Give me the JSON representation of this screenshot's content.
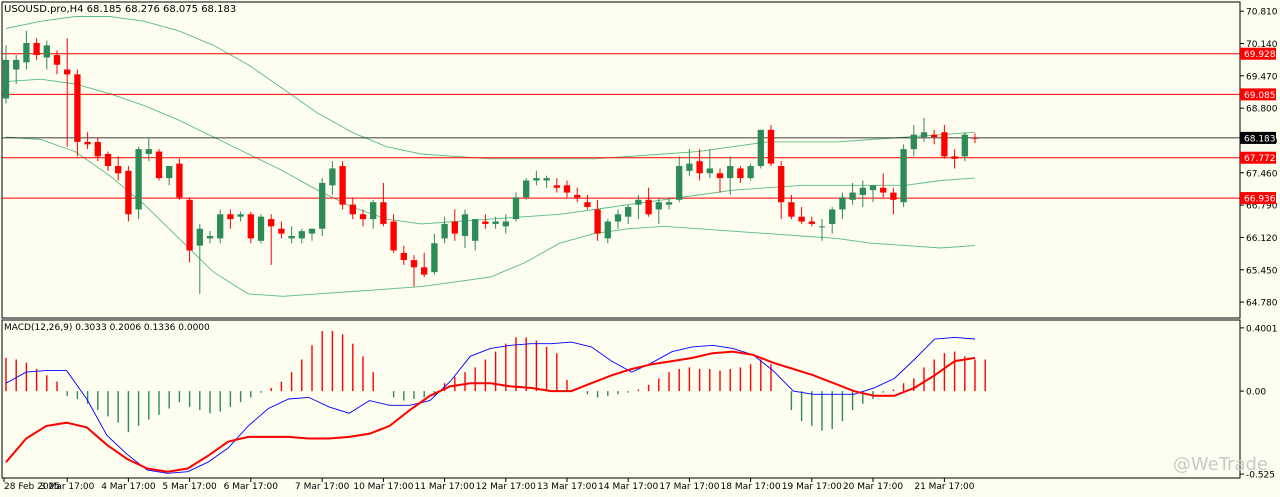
{
  "header": {
    "symbol_info": "USOUSD.pro,H4  68.185 68.276 68.075 68.183",
    "macd_info": "MACD(12,26,9) 0.3033 0.2006 0.1336 0.0000"
  },
  "watermark": "@WeTrade",
  "colors": {
    "background": "#fdfdf0",
    "bull": "#2e8b57",
    "bear": "#ff0000",
    "bands": "#3cb371",
    "level_line": "#ff0000",
    "macd_line": "#0000ff",
    "signal_line": "#ff0000"
  },
  "chart_data": [
    {
      "type": "candlestick",
      "symbol": "USOUSD.pro",
      "timeframe": "H4",
      "ylim": [
        64.45,
        71.0
      ],
      "y_ticks": [
        "70.810",
        "70.140",
        "69.470",
        "68.800",
        "68.130",
        "67.460",
        "66.790",
        "66.120",
        "65.450",
        "64.780"
      ],
      "x_ticks": [
        "28 Feb 2025",
        "3 Mar 17:00",
        "4 Mar 17:00",
        "5 Mar 17:00",
        "6 Mar 17:00",
        "7 Mar 17:00",
        "10 Mar 17:00",
        "11 Mar 17:00",
        "12 Mar 17:00",
        "13 Mar 17:00",
        "14 Mar 17:00",
        "17 Mar 17:00",
        "18 Mar 17:00",
        "19 Mar 17:00",
        "20 Mar 17:00",
        "21 Mar 17:00"
      ],
      "horizontal_levels": [
        {
          "value": 69.928,
          "label": "69.928"
        },
        {
          "value": 69.085,
          "label": "69.085"
        },
        {
          "value": 67.772,
          "label": "67.772"
        },
        {
          "value": 66.936,
          "label": "66.936"
        }
      ],
      "current_price": {
        "value": 68.183,
        "label": "68.183"
      },
      "candles": [
        [
          69.0,
          70.1,
          68.9,
          69.8
        ],
        [
          69.6,
          69.9,
          69.3,
          69.8
        ],
        [
          69.75,
          70.4,
          69.6,
          70.15
        ],
        [
          70.15,
          70.25,
          69.8,
          69.9
        ],
        [
          69.85,
          70.2,
          69.6,
          70.1
        ],
        [
          69.9,
          70.0,
          69.5,
          69.7
        ],
        [
          69.6,
          70.25,
          68.0,
          69.5
        ],
        [
          69.5,
          69.6,
          67.8,
          68.1
        ],
        [
          68.1,
          68.3,
          67.95,
          68.05
        ],
        [
          68.1,
          68.2,
          67.7,
          67.8
        ],
        [
          67.85,
          67.9,
          67.5,
          67.6
        ],
        [
          67.6,
          67.8,
          67.3,
          67.45
        ],
        [
          67.5,
          67.6,
          66.45,
          66.6
        ],
        [
          66.7,
          68.0,
          66.5,
          67.95
        ],
        [
          67.85,
          68.2,
          67.7,
          67.95
        ],
        [
          67.9,
          67.95,
          67.3,
          67.35
        ],
        [
          67.35,
          67.6,
          67.2,
          67.6
        ],
        [
          67.65,
          67.75,
          66.9,
          66.95
        ],
        [
          66.9,
          66.95,
          65.6,
          65.85
        ],
        [
          65.95,
          66.4,
          64.95,
          66.3
        ],
        [
          66.1,
          66.25,
          66.0,
          66.15
        ],
        [
          66.1,
          66.7,
          66.0,
          66.6
        ],
        [
          66.6,
          66.7,
          66.3,
          66.5
        ],
        [
          66.55,
          66.65,
          66.45,
          66.6
        ],
        [
          66.6,
          66.65,
          66.0,
          66.1
        ],
        [
          66.05,
          66.6,
          66.0,
          66.55
        ],
        [
          66.5,
          66.6,
          65.55,
          66.35
        ],
        [
          66.3,
          66.45,
          66.1,
          66.2
        ],
        [
          66.1,
          66.35,
          66.0,
          66.15
        ],
        [
          66.1,
          66.3,
          66.0,
          66.25
        ],
        [
          66.2,
          66.3,
          66.05,
          66.3
        ],
        [
          66.3,
          67.35,
          66.15,
          67.25
        ],
        [
          67.2,
          67.7,
          67.0,
          67.55
        ],
        [
          67.6,
          67.7,
          66.7,
          66.8
        ],
        [
          66.8,
          66.95,
          66.5,
          66.6
        ],
        [
          66.6,
          66.7,
          66.35,
          66.5
        ],
        [
          66.5,
          66.9,
          66.3,
          66.85
        ],
        [
          66.85,
          67.25,
          66.35,
          66.4
        ],
        [
          66.45,
          66.6,
          65.8,
          65.85
        ],
        [
          65.8,
          65.95,
          65.55,
          65.65
        ],
        [
          65.65,
          65.75,
          65.1,
          65.5
        ],
        [
          65.5,
          65.8,
          65.3,
          65.35
        ],
        [
          65.4,
          66.2,
          65.35,
          66.0
        ],
        [
          66.1,
          66.55,
          66.0,
          66.4
        ],
        [
          66.45,
          66.7,
          66.05,
          66.2
        ],
        [
          66.15,
          66.7,
          65.9,
          66.6
        ],
        [
          66.05,
          66.5,
          65.85,
          66.5
        ],
        [
          66.45,
          66.6,
          66.3,
          66.4
        ],
        [
          66.4,
          66.55,
          66.3,
          66.45
        ],
        [
          66.35,
          66.6,
          66.2,
          66.45
        ],
        [
          66.5,
          67.05,
          66.45,
          66.95
        ],
        [
          66.95,
          67.35,
          66.9,
          67.3
        ],
        [
          67.3,
          67.5,
          67.2,
          67.35
        ],
        [
          67.3,
          67.4,
          67.15,
          67.35
        ],
        [
          67.2,
          67.35,
          67.05,
          67.15
        ],
        [
          67.2,
          67.3,
          66.95,
          67.05
        ],
        [
          67.0,
          67.15,
          66.85,
          66.95
        ],
        [
          66.85,
          67.0,
          66.7,
          66.75
        ],
        [
          66.7,
          66.9,
          66.05,
          66.2
        ],
        [
          66.1,
          66.5,
          66.0,
          66.45
        ],
        [
          66.45,
          66.7,
          66.3,
          66.6
        ],
        [
          66.55,
          66.8,
          66.4,
          66.75
        ],
        [
          66.8,
          67.0,
          66.5,
          66.9
        ],
        [
          66.9,
          67.15,
          66.55,
          66.6
        ],
        [
          66.7,
          66.95,
          66.4,
          66.85
        ],
        [
          66.8,
          66.95,
          66.7,
          66.85
        ],
        [
          66.9,
          67.8,
          66.85,
          67.6
        ],
        [
          67.5,
          67.95,
          67.4,
          67.65
        ],
        [
          67.7,
          67.95,
          67.3,
          67.45
        ],
        [
          67.45,
          67.95,
          67.35,
          67.55
        ],
        [
          67.45,
          67.55,
          67.05,
          67.35
        ],
        [
          67.35,
          67.8,
          67.0,
          67.6
        ],
        [
          67.55,
          67.6,
          67.25,
          67.35
        ],
        [
          67.35,
          67.65,
          67.3,
          67.6
        ],
        [
          67.6,
          68.35,
          67.55,
          68.35
        ],
        [
          68.35,
          68.45,
          67.6,
          67.65
        ],
        [
          67.6,
          67.7,
          66.5,
          66.85
        ],
        [
          66.85,
          67.0,
          66.5,
          66.55
        ],
        [
          66.55,
          66.75,
          66.4,
          66.45
        ],
        [
          66.45,
          66.55,
          66.35,
          66.4
        ],
        [
          66.35,
          66.5,
          66.05,
          66.35
        ],
        [
          66.4,
          66.75,
          66.2,
          66.7
        ],
        [
          66.7,
          67.05,
          66.5,
          66.95
        ],
        [
          66.9,
          67.25,
          66.8,
          67.05
        ],
        [
          67.0,
          67.3,
          66.75,
          67.15
        ],
        [
          67.1,
          67.2,
          66.85,
          67.2
        ],
        [
          67.15,
          67.45,
          66.95,
          67.05
        ],
        [
          67.05,
          67.15,
          66.6,
          66.9
        ],
        [
          66.85,
          68.05,
          66.75,
          67.95
        ],
        [
          67.95,
          68.45,
          67.8,
          68.25
        ],
        [
          68.2,
          68.6,
          68.1,
          68.3
        ],
        [
          68.25,
          68.35,
          68.05,
          68.2
        ],
        [
          68.3,
          68.45,
          67.75,
          67.8
        ],
        [
          67.8,
          67.95,
          67.55,
          67.75
        ],
        [
          67.8,
          68.3,
          67.7,
          68.25
        ],
        [
          68.185,
          68.276,
          68.075,
          68.183
        ]
      ],
      "bollinger": {
        "upper": [
          70.45,
          70.6,
          70.7,
          70.7,
          70.6,
          70.4,
          70.1,
          69.7,
          69.2,
          68.7,
          68.3,
          68.0,
          67.85,
          67.8,
          67.75,
          67.75,
          67.75,
          67.75,
          67.8,
          67.85,
          67.9,
          68.0,
          68.1,
          68.1,
          68.1,
          68.15,
          68.2,
          68.25,
          68.3
        ],
        "mid": [
          69.35,
          69.4,
          69.3,
          69.1,
          68.85,
          68.55,
          68.2,
          67.85,
          67.5,
          67.1,
          66.75,
          66.5,
          66.4,
          66.45,
          66.5,
          66.55,
          66.6,
          66.7,
          66.8,
          66.9,
          67.0,
          67.1,
          67.15,
          67.2,
          67.2,
          67.2,
          67.2,
          67.3,
          67.35
        ],
        "lower": [
          68.2,
          68.15,
          67.9,
          67.4,
          66.8,
          66.1,
          65.4,
          64.95,
          64.9,
          64.95,
          65.0,
          65.05,
          65.1,
          65.2,
          65.3,
          65.6,
          66.0,
          66.2,
          66.3,
          66.35,
          66.3,
          66.25,
          66.2,
          66.15,
          66.1,
          66.0,
          65.95,
          65.9,
          65.95
        ]
      }
    },
    {
      "type": "histogram+line",
      "title": "MACD(12,26,9)",
      "ylim": [
        -0.55,
        0.45
      ],
      "y_ticks": [
        "0.4001",
        "0.00",
        "-0.525"
      ],
      "histogram": [
        0.21,
        0.2,
        0.18,
        0.14,
        0.1,
        0.06,
        -0.03,
        -0.05,
        -0.08,
        -0.12,
        -0.16,
        -0.2,
        -0.26,
        -0.22,
        -0.18,
        -0.15,
        -0.11,
        -0.07,
        -0.1,
        -0.12,
        -0.14,
        -0.13,
        -0.1,
        -0.07,
        -0.04,
        -0.01,
        0.02,
        0.06,
        0.12,
        0.2,
        0.29,
        0.38,
        0.38,
        0.36,
        0.3,
        0.22,
        0.12,
        0.0,
        -0.04,
        -0.06,
        -0.05,
        -0.04,
        -0.03,
        0.05,
        0.09,
        0.12,
        0.15,
        0.2,
        0.25,
        0.3,
        0.34,
        0.34,
        0.32,
        0.28,
        0.24,
        0.07,
        0.0,
        -0.02,
        -0.04,
        -0.03,
        -0.02,
        -0.01,
        0.01,
        0.04,
        0.08,
        0.12,
        0.14,
        0.15,
        0.14,
        0.14,
        0.13,
        0.14,
        0.15,
        0.17,
        0.2,
        0.17,
        0.0,
        -0.12,
        -0.19,
        -0.22,
        -0.25,
        -0.24,
        -0.19,
        -0.12,
        -0.08,
        -0.05,
        -0.01,
        0.01,
        0.05,
        0.08,
        0.15,
        0.2,
        0.24,
        0.25,
        0.22,
        0.2,
        0.2
      ],
      "macd_line": [
        0.05,
        0.12,
        0.13,
        0.13,
        -0.05,
        -0.28,
        -0.4,
        -0.5,
        -0.52,
        -0.51,
        -0.45,
        -0.36,
        -0.22,
        -0.11,
        -0.05,
        -0.04,
        -0.1,
        -0.14,
        -0.06,
        -0.09,
        -0.09,
        -0.06,
        0.06,
        0.22,
        0.27,
        0.29,
        0.3,
        0.3,
        0.31,
        0.28,
        0.19,
        0.12,
        0.18,
        0.25,
        0.28,
        0.29,
        0.27,
        0.23,
        0.13,
        0.0,
        -0.02,
        -0.02,
        -0.02,
        0.02,
        0.08,
        0.2,
        0.33,
        0.34,
        0.33
      ],
      "signal_line": [
        -0.45,
        -0.3,
        -0.22,
        -0.2,
        -0.23,
        -0.34,
        -0.43,
        -0.49,
        -0.51,
        -0.49,
        -0.41,
        -0.32,
        -0.29,
        -0.29,
        -0.29,
        -0.3,
        -0.3,
        -0.29,
        -0.27,
        -0.22,
        -0.12,
        -0.03,
        0.03,
        0.05,
        0.05,
        0.03,
        0.02,
        0.0,
        0.0,
        0.05,
        0.1,
        0.14,
        0.17,
        0.19,
        0.21,
        0.24,
        0.25,
        0.23,
        0.18,
        0.14,
        0.1,
        0.05,
        0.0,
        -0.03,
        -0.03,
        0.02,
        0.1,
        0.19,
        0.21
      ]
    }
  ]
}
